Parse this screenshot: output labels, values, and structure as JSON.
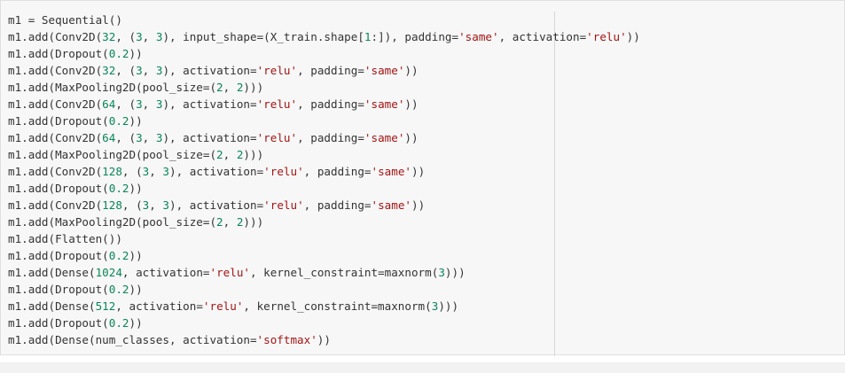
{
  "cell": {
    "lines": [
      [
        {
          "t": "p",
          "v": "m1 = Sequential()"
        }
      ],
      [
        {
          "t": "p",
          "v": "m1.add(Conv2D("
        },
        {
          "t": "num",
          "v": "32"
        },
        {
          "t": "p",
          "v": ", ("
        },
        {
          "t": "num",
          "v": "3"
        },
        {
          "t": "p",
          "v": ", "
        },
        {
          "t": "num",
          "v": "3"
        },
        {
          "t": "p",
          "v": "), input_shape=(X_train.shape["
        },
        {
          "t": "num",
          "v": "1"
        },
        {
          "t": "p",
          "v": ":]), padding="
        },
        {
          "t": "str",
          "v": "'same'"
        },
        {
          "t": "p",
          "v": ", activation="
        },
        {
          "t": "str",
          "v": "'relu'"
        },
        {
          "t": "p",
          "v": "))"
        }
      ],
      [
        {
          "t": "p",
          "v": "m1.add(Dropout("
        },
        {
          "t": "num",
          "v": "0.2"
        },
        {
          "t": "p",
          "v": "))"
        }
      ],
      [
        {
          "t": "p",
          "v": "m1.add(Conv2D("
        },
        {
          "t": "num",
          "v": "32"
        },
        {
          "t": "p",
          "v": ", ("
        },
        {
          "t": "num",
          "v": "3"
        },
        {
          "t": "p",
          "v": ", "
        },
        {
          "t": "num",
          "v": "3"
        },
        {
          "t": "p",
          "v": "), activation="
        },
        {
          "t": "str",
          "v": "'relu'"
        },
        {
          "t": "p",
          "v": ", padding="
        },
        {
          "t": "str",
          "v": "'same'"
        },
        {
          "t": "p",
          "v": "))"
        }
      ],
      [
        {
          "t": "p",
          "v": "m1.add(MaxPooling2D(pool_size=("
        },
        {
          "t": "num",
          "v": "2"
        },
        {
          "t": "p",
          "v": ", "
        },
        {
          "t": "num",
          "v": "2"
        },
        {
          "t": "p",
          "v": ")))"
        }
      ],
      [
        {
          "t": "p",
          "v": "m1.add(Conv2D("
        },
        {
          "t": "num",
          "v": "64"
        },
        {
          "t": "p",
          "v": ", ("
        },
        {
          "t": "num",
          "v": "3"
        },
        {
          "t": "p",
          "v": ", "
        },
        {
          "t": "num",
          "v": "3"
        },
        {
          "t": "p",
          "v": "), activation="
        },
        {
          "t": "str",
          "v": "'relu'"
        },
        {
          "t": "p",
          "v": ", padding="
        },
        {
          "t": "str",
          "v": "'same'"
        },
        {
          "t": "p",
          "v": "))"
        }
      ],
      [
        {
          "t": "p",
          "v": "m1.add(Dropout("
        },
        {
          "t": "num",
          "v": "0.2"
        },
        {
          "t": "p",
          "v": "))"
        }
      ],
      [
        {
          "t": "p",
          "v": "m1.add(Conv2D("
        },
        {
          "t": "num",
          "v": "64"
        },
        {
          "t": "p",
          "v": ", ("
        },
        {
          "t": "num",
          "v": "3"
        },
        {
          "t": "p",
          "v": ", "
        },
        {
          "t": "num",
          "v": "3"
        },
        {
          "t": "p",
          "v": "), activation="
        },
        {
          "t": "str",
          "v": "'relu'"
        },
        {
          "t": "p",
          "v": ", padding="
        },
        {
          "t": "str",
          "v": "'same'"
        },
        {
          "t": "p",
          "v": "))"
        }
      ],
      [
        {
          "t": "p",
          "v": "m1.add(MaxPooling2D(pool_size=("
        },
        {
          "t": "num",
          "v": "2"
        },
        {
          "t": "p",
          "v": ", "
        },
        {
          "t": "num",
          "v": "2"
        },
        {
          "t": "p",
          "v": ")))"
        }
      ],
      [
        {
          "t": "p",
          "v": "m1.add(Conv2D("
        },
        {
          "t": "num",
          "v": "128"
        },
        {
          "t": "p",
          "v": ", ("
        },
        {
          "t": "num",
          "v": "3"
        },
        {
          "t": "p",
          "v": ", "
        },
        {
          "t": "num",
          "v": "3"
        },
        {
          "t": "p",
          "v": "), activation="
        },
        {
          "t": "str",
          "v": "'relu'"
        },
        {
          "t": "p",
          "v": ", padding="
        },
        {
          "t": "str",
          "v": "'same'"
        },
        {
          "t": "p",
          "v": "))"
        }
      ],
      [
        {
          "t": "p",
          "v": "m1.add(Dropout("
        },
        {
          "t": "num",
          "v": "0.2"
        },
        {
          "t": "p",
          "v": "))"
        }
      ],
      [
        {
          "t": "p",
          "v": "m1.add(Conv2D("
        },
        {
          "t": "num",
          "v": "128"
        },
        {
          "t": "p",
          "v": ", ("
        },
        {
          "t": "num",
          "v": "3"
        },
        {
          "t": "p",
          "v": ", "
        },
        {
          "t": "num",
          "v": "3"
        },
        {
          "t": "p",
          "v": "), activation="
        },
        {
          "t": "str",
          "v": "'relu'"
        },
        {
          "t": "p",
          "v": ", padding="
        },
        {
          "t": "str",
          "v": "'same'"
        },
        {
          "t": "p",
          "v": "))"
        }
      ],
      [
        {
          "t": "p",
          "v": "m1.add(MaxPooling2D(pool_size=("
        },
        {
          "t": "num",
          "v": "2"
        },
        {
          "t": "p",
          "v": ", "
        },
        {
          "t": "num",
          "v": "2"
        },
        {
          "t": "p",
          "v": ")))"
        }
      ],
      [
        {
          "t": "p",
          "v": "m1.add(Flatten())"
        }
      ],
      [
        {
          "t": "p",
          "v": "m1.add(Dropout("
        },
        {
          "t": "num",
          "v": "0.2"
        },
        {
          "t": "p",
          "v": "))"
        }
      ],
      [
        {
          "t": "p",
          "v": "m1.add(Dense("
        },
        {
          "t": "num",
          "v": "1024"
        },
        {
          "t": "p",
          "v": ", activation="
        },
        {
          "t": "str",
          "v": "'relu'"
        },
        {
          "t": "p",
          "v": ", kernel_constraint=maxnorm("
        },
        {
          "t": "num",
          "v": "3"
        },
        {
          "t": "p",
          "v": ")))"
        }
      ],
      [
        {
          "t": "p",
          "v": "m1.add(Dropout("
        },
        {
          "t": "num",
          "v": "0.2"
        },
        {
          "t": "p",
          "v": "))"
        }
      ],
      [
        {
          "t": "p",
          "v": "m1.add(Dense("
        },
        {
          "t": "num",
          "v": "512"
        },
        {
          "t": "p",
          "v": ", activation="
        },
        {
          "t": "str",
          "v": "'relu'"
        },
        {
          "t": "p",
          "v": ", kernel_constraint=maxnorm("
        },
        {
          "t": "num",
          "v": "3"
        },
        {
          "t": "p",
          "v": ")))"
        }
      ],
      [
        {
          "t": "p",
          "v": "m1.add(Dropout("
        },
        {
          "t": "num",
          "v": "0.2"
        },
        {
          "t": "p",
          "v": "))"
        }
      ],
      [
        {
          "t": "p",
          "v": "m1.add(Dense(num_classes, activation="
        },
        {
          "t": "str",
          "v": "'softmax'"
        },
        {
          "t": "p",
          "v": "))"
        }
      ]
    ]
  }
}
